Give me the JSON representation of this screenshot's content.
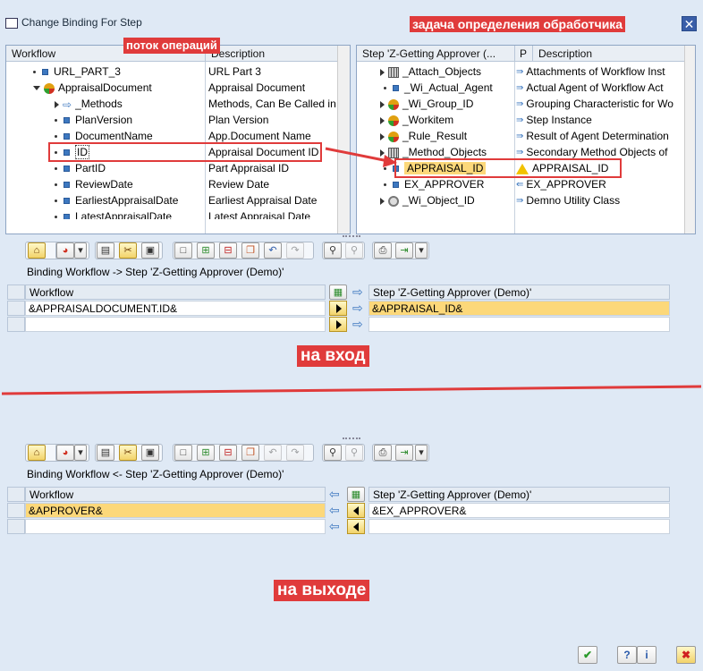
{
  "window": {
    "title": "Change Binding For Step",
    "close": "✕"
  },
  "annotations": {
    "task": "задача определения обработчика",
    "flow": "поток операций",
    "input": "на вход",
    "output": "на выходе"
  },
  "left_tree": {
    "headers": {
      "col1": "Workflow",
      "col2": "Description"
    },
    "rows": [
      {
        "name": "URL_PART_3",
        "desc": "URL Part 3"
      },
      {
        "name": "AppraisalDocument",
        "desc": "Appraisal Document"
      },
      {
        "name": "_Methods",
        "desc": "Methods, Can Be Called in"
      },
      {
        "name": "PlanVersion",
        "desc": "Plan Version"
      },
      {
        "name": "DocumentName",
        "desc": "App.Document Name"
      },
      {
        "name": "ID",
        "desc": "Appraisal Document ID"
      },
      {
        "name": "PartID",
        "desc": "Part Appraisal ID"
      },
      {
        "name": "ReviewDate",
        "desc": "Review Date"
      },
      {
        "name": "EarliestAppraisalDate",
        "desc": "Earliest Appraisal Date"
      },
      {
        "name": "LatestAppraisalDate",
        "desc": "Latest Appraisal Date"
      }
    ]
  },
  "right_tree": {
    "headers": {
      "col1": "Step 'Z-Getting Approver (...",
      "col2": "P",
      "col3": "Description"
    },
    "rows": [
      {
        "name": "_Attach_Objects",
        "desc": "Attachments of Workflow Inst"
      },
      {
        "name": "_Wi_Actual_Agent",
        "desc": "Actual Agent of Workflow Act"
      },
      {
        "name": "_Wi_Group_ID",
        "desc": "Grouping Characteristic for Wo"
      },
      {
        "name": "_Workitem",
        "desc": "Step Instance"
      },
      {
        "name": "_Rule_Result",
        "desc": "Result of Agent Determination"
      },
      {
        "name": "_Method_Objects",
        "desc": "Secondary Method Objects of"
      },
      {
        "name": "APPRAISAL_ID",
        "desc": "APPRAISAL_ID"
      },
      {
        "name": "EX_APPROVER",
        "desc": "EX_APPROVER"
      },
      {
        "name": "_Wi_Object_ID",
        "desc": "Demno Utility Class"
      }
    ]
  },
  "binding_in": {
    "label": "Binding Workflow  -> Step 'Z-Getting Approver (Demo)'",
    "left_header": "Workflow",
    "right_header": "Step 'Z-Getting Approver (Demo)'",
    "left": "&APPRAISALDOCUMENT.ID&",
    "right": "&APPRAISAL_ID&"
  },
  "binding_out": {
    "label": "Binding Workflow  <- Step 'Z-Getting Approver (Demo)'",
    "left_header": "Workflow",
    "right_header": "Step 'Z-Getting Approver (Demo)'",
    "left": "&APPROVER&",
    "right": "&EX_APPROVER&"
  },
  "colors": {
    "accent": "#e03b3b",
    "highlight": "#fcd87a",
    "panel_bg": "#dfe9f5"
  }
}
